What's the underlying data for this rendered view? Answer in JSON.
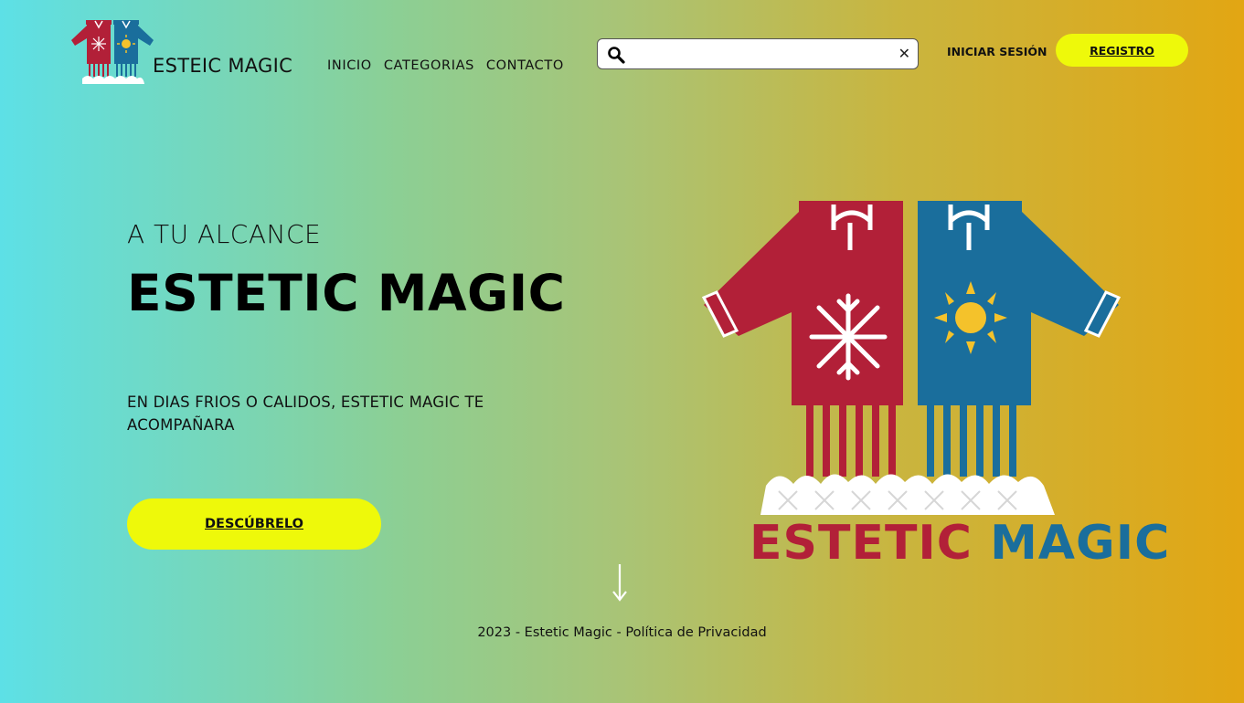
{
  "header": {
    "brand": "ESTEIC MAGIC",
    "nav": [
      {
        "label": "INICIO"
      },
      {
        "label": "CATEGORIAS"
      },
      {
        "label": "CONTACTO"
      }
    ],
    "search": {
      "value": "",
      "placeholder": ""
    },
    "login_label": "INICIAR SESIÓN",
    "register_label": "REGISTRO"
  },
  "hero": {
    "kicker": "A TU ALCANCE",
    "title": "ESTETIC MAGIC",
    "text": "EN DIAS FRIOS O CALIDOS, ESTETIC MAGIC TE ACOMPAÑARA",
    "cta_label": "DESCÚBRELO",
    "wordmark_part1": "ESTETIC",
    "wordmark_part2": "MAGIC"
  },
  "footer": {
    "text": "2023 - Estetic Magic - Política de Privacidad"
  },
  "icons": {
    "logo": "sweaters-logo-icon",
    "search": "search-icon",
    "clear": "close-icon",
    "scroll": "arrow-down-icon",
    "illustration": "sweaters-illustration"
  },
  "colors": {
    "accent_yellow": "#eef90a",
    "sweater_red": "#b22038",
    "sweater_blue": "#1a6e9c",
    "gradient_start": "#5de0e6",
    "gradient_end": "#e2a613"
  }
}
